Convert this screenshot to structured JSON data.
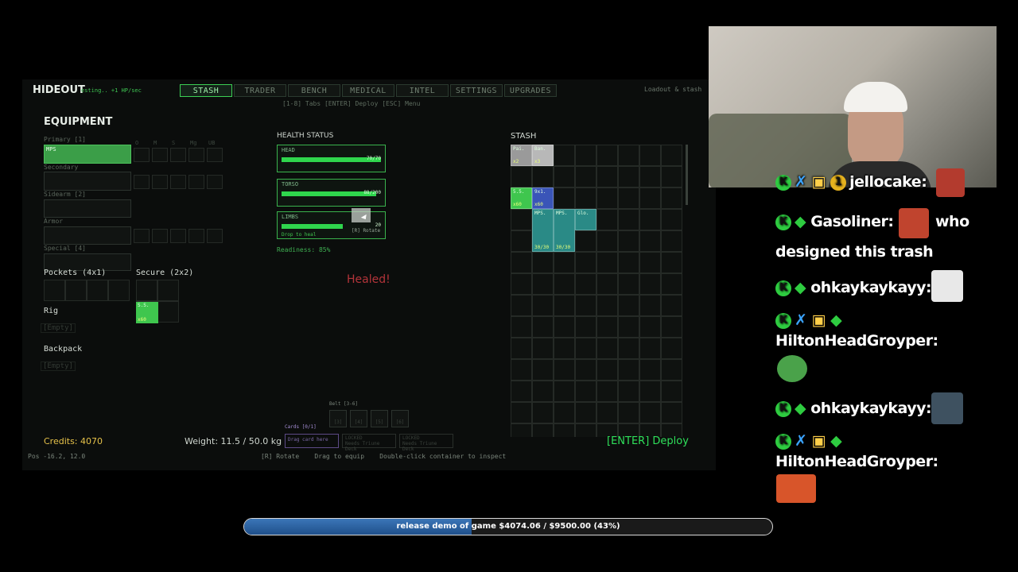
{
  "game": {
    "title": "HIDEOUT",
    "subtitle": "esting.. +1 HP/sec",
    "tabs": [
      "STASH",
      "TRADER",
      "BENCH",
      "MEDICAL",
      "INTEL",
      "SETTINGS",
      "UPGRADES"
    ],
    "active_tab": "STASH",
    "hint_top": "[1-8] Tabs  [ENTER] Deploy  [ESC] Menu",
    "top_right": "Loadout & stash",
    "equipment": {
      "title": "EQUIPMENT",
      "primary_label": "Primary [1]",
      "primary_item": "MPS",
      "secondary_label": "Secondary",
      "sidearm_label": "Sidearm [2]",
      "armor_label": "Armor",
      "special_label": "Special [4]",
      "mods": [
        "O",
        "M",
        "S",
        "Mg",
        "UB"
      ],
      "pockets_label": "Pockets (4x1)",
      "secure_label": "Secure (2x2)",
      "secure_item": "S.S.",
      "secure_item_count": "x60",
      "rig_label": "Rig",
      "rig_empty": "[Empty]",
      "backpack_label": "Backpack",
      "backpack_empty": "[Empty]"
    },
    "health": {
      "title": "HEALTH STATUS",
      "head_label": "HEAD",
      "head_value": "70/70",
      "head_fill": 1.0,
      "torso_label": "TORSO",
      "torso_value": "88/200",
      "torso_fill": 0.95,
      "limbs_label": "LIMBS",
      "limbs_sub": "Drop to heal",
      "limbs_value": "20",
      "limbs_fill": 0.7,
      "drag_hint": "[R] Rotate",
      "readiness": "Readiness: 85%",
      "healed": "Healed!"
    },
    "stash": {
      "title": "STASH",
      "items": [
        {
          "name": "Pai.",
          "count": "x2"
        },
        {
          "name": "Ban.",
          "count": "x3"
        },
        {
          "name": "5.5.",
          "count": "x60"
        },
        {
          "name": "9x1.",
          "count": "x60"
        },
        {
          "name": "MPS.",
          "count": "30/30"
        },
        {
          "name": "MPS.",
          "count": "30/30"
        },
        {
          "name": "Glo.",
          "count": ""
        }
      ]
    },
    "belt_label": "Belt [3-6]",
    "belt_slots": [
      "[3]",
      "[4]",
      "[5]",
      "[6]"
    ],
    "cards_label": "Cards [0/1]",
    "card_drop": "Drag card here",
    "locked1": "LOCKED",
    "locked1_sub": "Needs Triune Deck",
    "locked2": "LOCKED",
    "locked2_sub": "Needs Triune Deck",
    "credits": "Credits: 4070",
    "weight": "Weight: 11.5 / 50.0 kg",
    "deploy": "[ENTER] Deploy",
    "pos": "Pos -16.2, 12.0",
    "bottom_hints": "[R] Rotate    Drag to equip    Double-click container to inspect"
  },
  "chat": [
    {
      "user": "jellocake:",
      "text": ""
    },
    {
      "user": "Gasoliner:",
      "text": "who"
    },
    {
      "user": "",
      "text": "designed this trash"
    },
    {
      "user": "ohkaykaykayy:",
      "text": ""
    },
    {
      "user": "HiltonHeadGroyper:",
      "text": ""
    },
    {
      "user": "ohkaykaykayy:",
      "text": ""
    },
    {
      "user": "HiltonHeadGroyper:",
      "text": ""
    }
  ],
  "goal": {
    "text": "release demo of game $4074.06 / $9500.00 (43%)",
    "progress": 0.43
  },
  "colors": {
    "accent": "#3ccf54",
    "credits": "#e6c24a",
    "deploy": "#2fe05a",
    "healed": "#b3343a"
  }
}
